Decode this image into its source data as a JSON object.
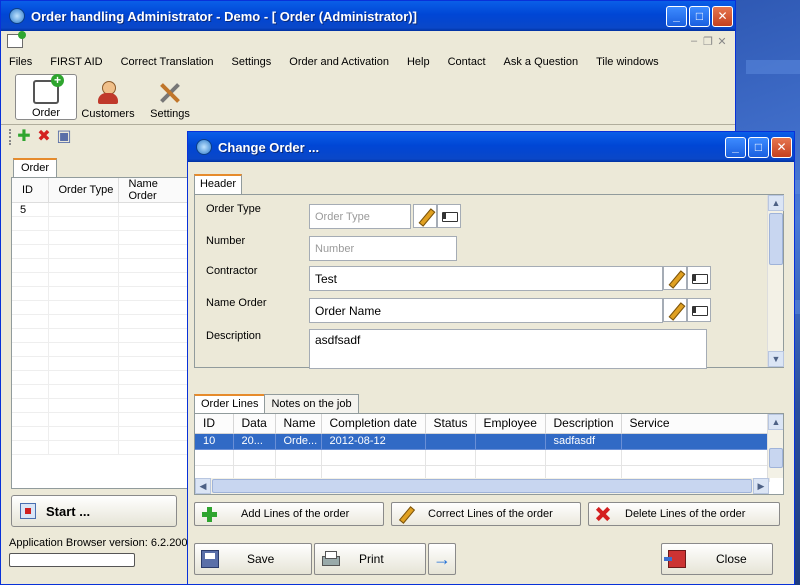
{
  "main_window": {
    "title": "Order handling  Administrator - Demo - [      Order (Administrator)]",
    "menu": [
      "Files",
      "FIRST AID",
      "Correct Translation",
      "Settings",
      "Order and Activation",
      "Help",
      "Contact",
      "Ask a Question",
      "Tile windows"
    ],
    "toolbar": [
      {
        "label": "Order",
        "icon": "order-icon",
        "active": true
      },
      {
        "label": "Customers",
        "icon": "customers-icon",
        "active": false
      },
      {
        "label": "Settings",
        "icon": "settings-icon",
        "active": false
      }
    ],
    "order_tab": "Order",
    "order_grid": {
      "columns": [
        "ID",
        "Order Type",
        "Name Order"
      ],
      "rows": [
        [
          "5",
          "",
          ""
        ]
      ]
    },
    "start_button": "Start ...",
    "status_text": "Application Browser version: 6.2.200,",
    "window_buttons": {
      "minimize": "_",
      "maximize": "□",
      "close": "✕"
    }
  },
  "dialog": {
    "title": "Change Order ...",
    "header_tab": "Header",
    "fields": {
      "order_type": {
        "label": "Order Type",
        "value": "",
        "placeholder": "Order Type"
      },
      "number": {
        "label": "Number",
        "value": "",
        "placeholder": "Number"
      },
      "contractor": {
        "label": "Contractor",
        "value": "Test"
      },
      "name_order": {
        "label": "Name Order",
        "value": "Order Name"
      },
      "description": {
        "label": "Description",
        "value": "asdfsadf"
      }
    },
    "tabs": [
      "Order Lines",
      "Notes on the job"
    ],
    "lines_grid": {
      "columns": [
        "ID",
        "Data",
        "Name",
        "Completion date",
        "Status",
        "Employee",
        "Description",
        "Service"
      ],
      "rows": [
        [
          "10",
          "20...",
          "Orde...",
          "2012-08-12",
          "",
          "",
          "sadfasdf",
          ""
        ]
      ]
    },
    "line_actions": {
      "add": "Add Lines of the order",
      "correct": "Correct Lines of the order",
      "delete": "Delete Lines of the order"
    },
    "bottom_buttons": {
      "save": "Save",
      "print": "Print",
      "next": "→",
      "close": "Close"
    }
  }
}
